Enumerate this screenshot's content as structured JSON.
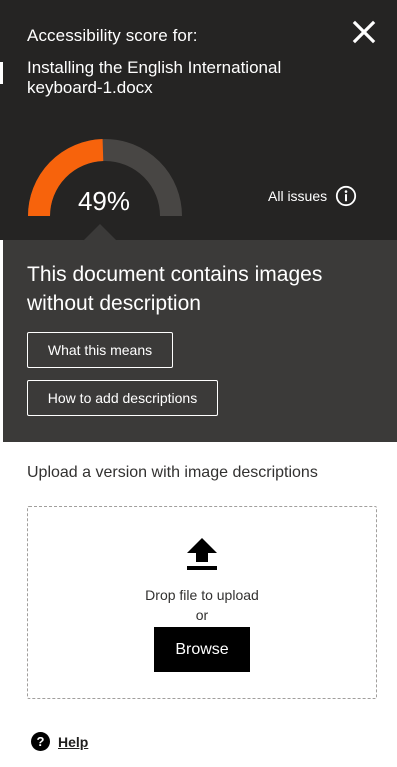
{
  "header": {
    "title": "Accessibility score for:",
    "document_name": "Installing the English International keyboard-1.docx",
    "close_icon": "close-icon"
  },
  "score": {
    "value": 0.49,
    "label": "49%",
    "filled_color": "#f7630c",
    "track_color": "#484644"
  },
  "all_issues": {
    "label": "All issues",
    "icon": "info-circle-icon"
  },
  "issue": {
    "title": "This document contains images without description",
    "what_means_label": "What this means",
    "how_to_label": "How to add descriptions"
  },
  "upload": {
    "label": "Upload a version with image descriptions",
    "icon": "upload-arrow-icon",
    "drop_text": "Drop file to upload",
    "or_text": "or",
    "browse_label": "Browse"
  },
  "help": {
    "label": "Help",
    "icon": "question-circle-icon"
  },
  "colors": {
    "header_bg": "#252423",
    "issue_bg": "#3b3a39",
    "accent": "#f7630c"
  }
}
